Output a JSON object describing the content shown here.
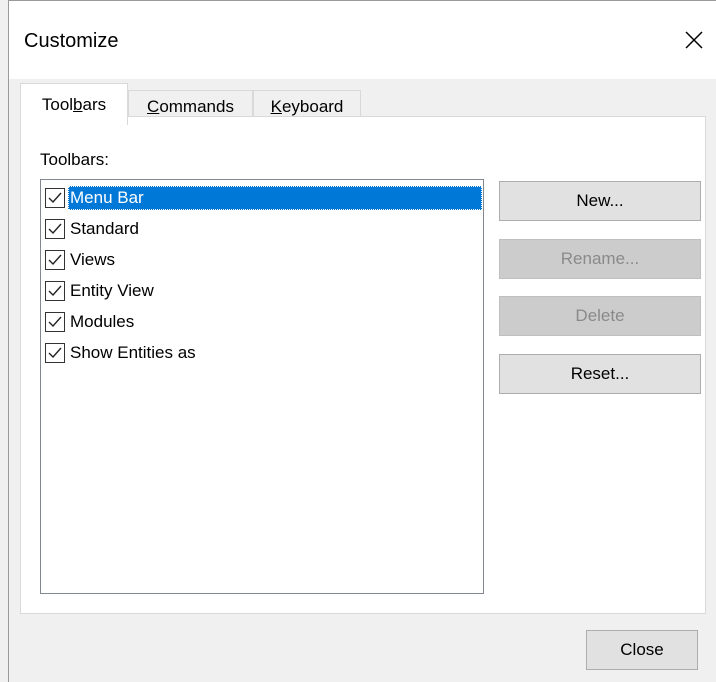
{
  "dialog": {
    "title": "Customize"
  },
  "tabs": [
    {
      "label_pre": "Tool",
      "label_u": "b",
      "label_post": "ars",
      "active": true
    },
    {
      "label_pre": "",
      "label_u": "C",
      "label_post": "ommands",
      "active": false
    },
    {
      "label_pre": "",
      "label_u": "K",
      "label_post": "eyboard",
      "active": false
    }
  ],
  "toolbars_panel": {
    "group_label": "Toolbars:",
    "items": [
      {
        "label": "Menu Bar",
        "checked": true,
        "selected": true
      },
      {
        "label": "Standard",
        "checked": true,
        "selected": false
      },
      {
        "label": "Views",
        "checked": true,
        "selected": false
      },
      {
        "label": "Entity View",
        "checked": true,
        "selected": false
      },
      {
        "label": "Modules",
        "checked": true,
        "selected": false
      },
      {
        "label": "Show Entities as",
        "checked": true,
        "selected": false
      }
    ]
  },
  "buttons": {
    "new_label": "New...",
    "rename_label": "Rename...",
    "delete_label": "Delete",
    "reset_label": "Reset...",
    "close_label": "Close"
  },
  "colors": {
    "selection": "#0078d7",
    "dialog_bg": "#f0f0f0",
    "disabled_text": "#8a8a8a"
  }
}
